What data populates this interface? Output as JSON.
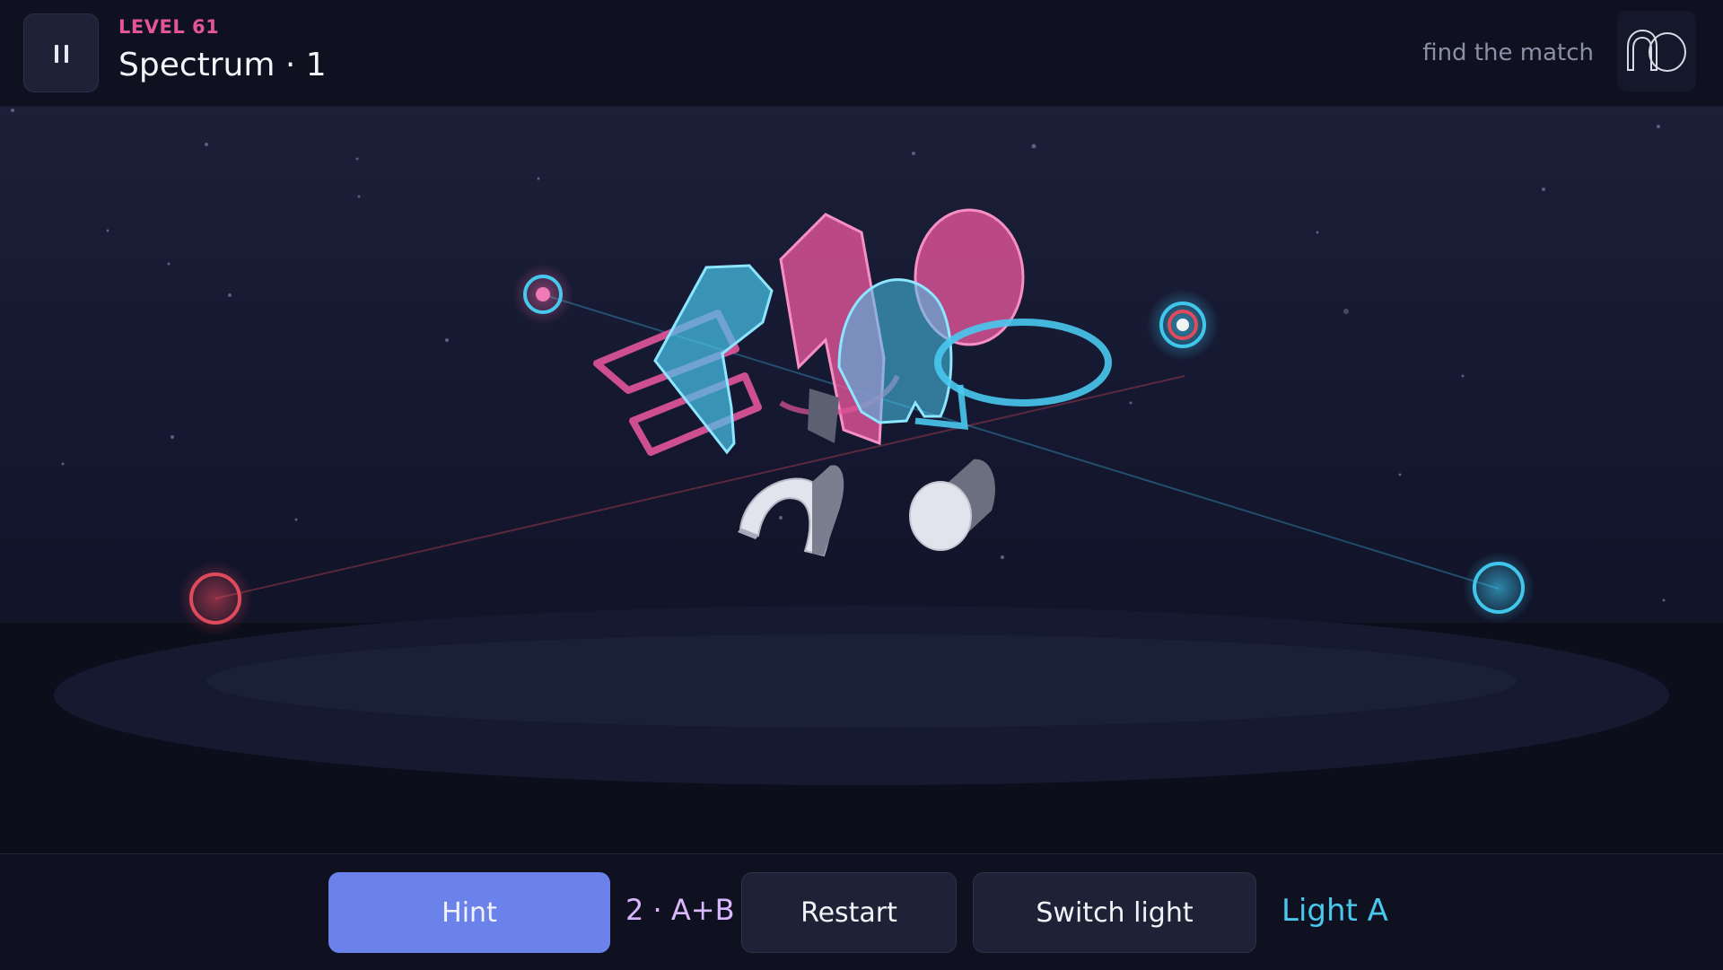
{
  "header": {
    "level_label": "LEVEL 61",
    "level_title": "Spectrum · 1",
    "objective": "find the match"
  },
  "icons": {
    "pause": "pause-icon",
    "logo": "arch-circle-logo-icon"
  },
  "toolbar": {
    "hint_label": "Hint",
    "combo_label": "2 · A+B",
    "restart_label": "Restart",
    "switch_label": "Switch light",
    "active_light": "Light A"
  },
  "colors": {
    "accent_pink": "#e2559a",
    "accent_cyan": "#49c8ee",
    "hint_button": "#6b82ea",
    "light_red": "#e04b5c"
  }
}
